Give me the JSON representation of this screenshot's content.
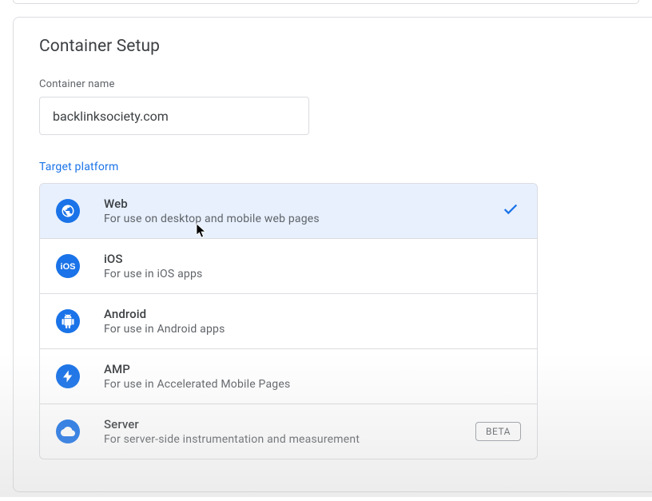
{
  "card_title": "Container Setup",
  "container_name_label": "Container name",
  "container_name_value": "backlinksociety.com",
  "target_platform_label": "Target platform",
  "platforms": [
    {
      "title": "Web",
      "desc": "For use on desktop and mobile web pages",
      "selected": true
    },
    {
      "title": "iOS",
      "desc": "For use in iOS apps",
      "selected": false
    },
    {
      "title": "Android",
      "desc": "For use in Android apps",
      "selected": false
    },
    {
      "title": "AMP",
      "desc": "For use in Accelerated Mobile Pages",
      "selected": false
    },
    {
      "title": "Server",
      "desc": "For server-side instrumentation and measurement",
      "selected": false,
      "badge": "BETA"
    }
  ]
}
